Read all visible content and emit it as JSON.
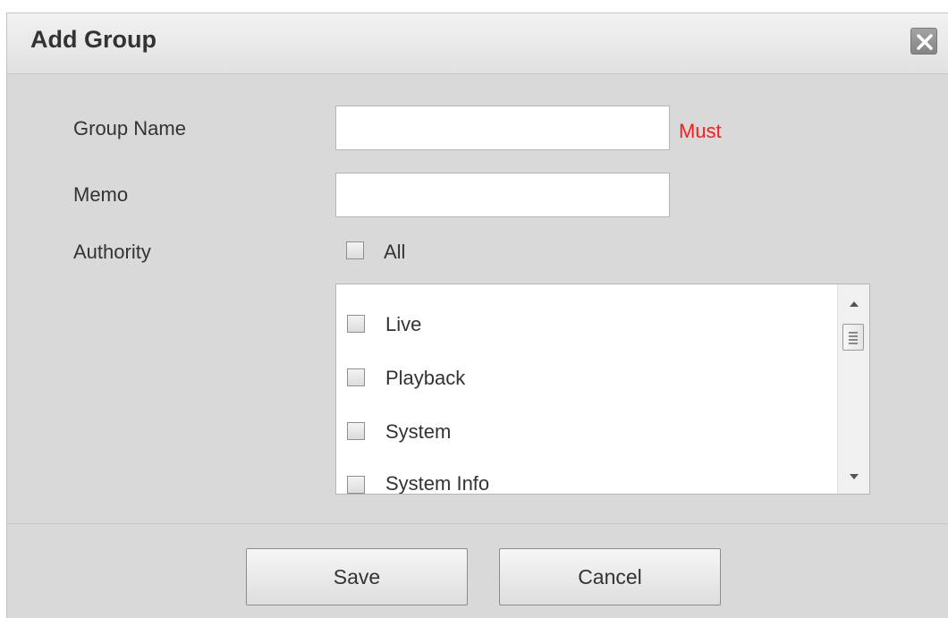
{
  "dialog": {
    "title": "Add Group",
    "close_icon": "close-icon"
  },
  "form": {
    "group_name": {
      "label": "Group Name",
      "value": "",
      "placeholder": "",
      "required_label": "Must"
    },
    "memo": {
      "label": "Memo",
      "value": "",
      "placeholder": ""
    },
    "authority": {
      "label": "Authority",
      "all_label": "All",
      "all_checked": false,
      "items": [
        {
          "label": "Live",
          "checked": false
        },
        {
          "label": "Playback",
          "checked": false
        },
        {
          "label": "System",
          "checked": false
        },
        {
          "label": "System Info",
          "checked": false
        }
      ]
    }
  },
  "buttons": {
    "save_label": "Save",
    "cancel_label": "Cancel"
  },
  "colors": {
    "required": "#ff1a1a",
    "dialog_bg": "#d9d9d9",
    "text": "#333333"
  }
}
